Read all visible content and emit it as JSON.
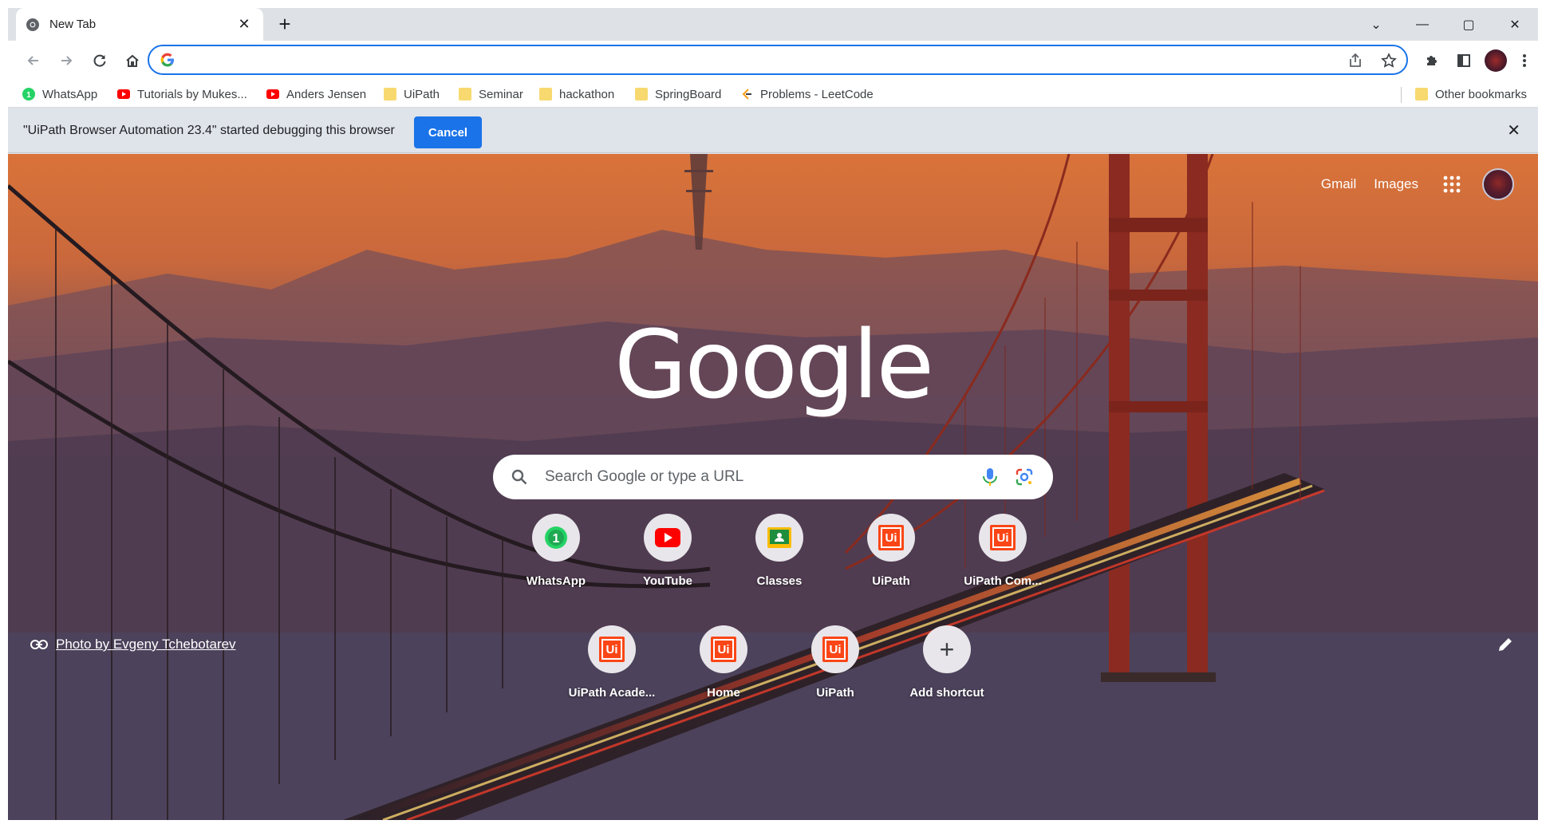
{
  "tab": {
    "title": "New Tab",
    "close": "✕"
  },
  "new_tab_label": "+",
  "window": {
    "minimize": "—",
    "maximize": "▢",
    "close": "✕",
    "tab_search": "⌄"
  },
  "omnibox": {
    "value": "",
    "placeholder": ""
  },
  "bookmarks": [
    {
      "label": "WhatsApp",
      "icon": "whatsapp-icon"
    },
    {
      "label": "Tutorials by Mukes...",
      "icon": "youtube-icon"
    },
    {
      "label": "Anders Jensen",
      "icon": "youtube-icon"
    },
    {
      "label": "UiPath",
      "icon": "folder-icon"
    },
    {
      "label": "Seminar",
      "icon": "folder-icon"
    },
    {
      "label": "hackathon",
      "icon": "folder-icon"
    },
    {
      "label": "SpringBoard",
      "icon": "folder-icon"
    },
    {
      "label": "Problems - LeetCode",
      "icon": "leetcode-icon"
    }
  ],
  "other_bookmarks": "Other bookmarks",
  "infobar": {
    "message": "\"UiPath Browser Automation 23.4\" started debugging this browser",
    "cancel": "Cancel",
    "close": "✕"
  },
  "ntp": {
    "gmail": "Gmail",
    "images": "Images",
    "logo": "Google",
    "search_placeholder": "Search Google or type a URL",
    "shortcuts": [
      {
        "label": "WhatsApp",
        "icon": "whatsapp-icon"
      },
      {
        "label": "YouTube",
        "icon": "youtube-icon"
      },
      {
        "label": "Classes",
        "icon": "classroom-icon"
      },
      {
        "label": "UiPath",
        "icon": "uipath-icon"
      },
      {
        "label": "UiPath Com...",
        "icon": "uipath-icon"
      },
      {
        "label": "UiPath Acade...",
        "icon": "uipath-icon"
      },
      {
        "label": "Home",
        "icon": "uipath-icon"
      },
      {
        "label": "UiPath",
        "icon": "uipath-icon"
      },
      {
        "label": "Add shortcut",
        "icon": "plus-icon"
      }
    ],
    "uipath_glyph": "Ui",
    "plus_glyph": "+",
    "whatsapp_badge": "1",
    "photo_credit": "Photo by Evgeny Tchebotarev"
  },
  "colors": {
    "accent": "#1a73e8",
    "uipath": "#fa4616",
    "youtube": "#ff0000",
    "whatsapp": "#25d366"
  }
}
